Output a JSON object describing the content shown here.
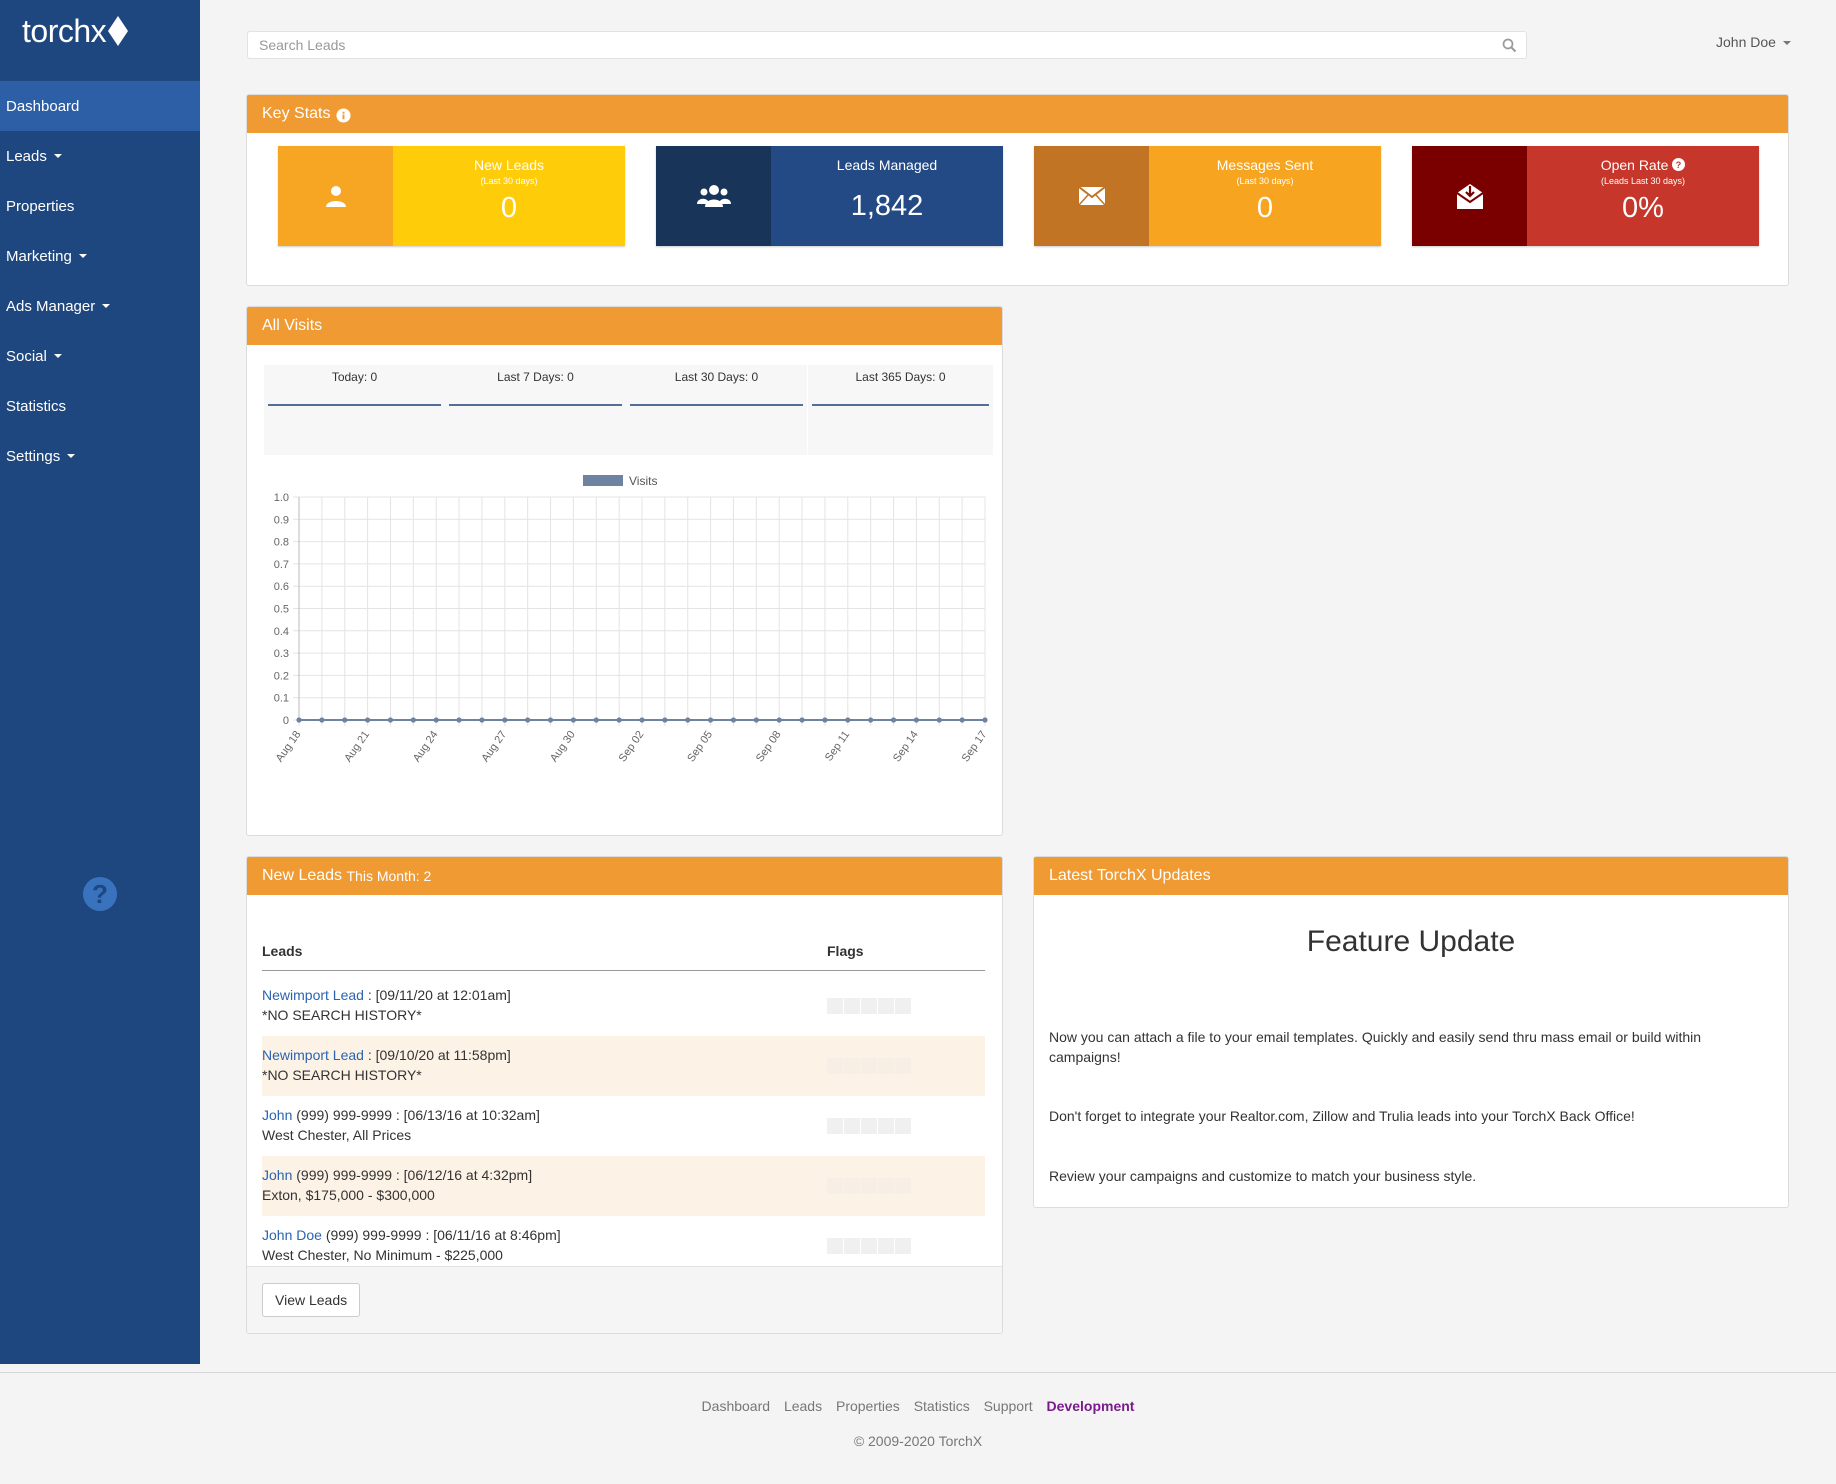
{
  "brand": {
    "logo_text": "torchx"
  },
  "sidebar": {
    "items": [
      {
        "label": "Dashboard"
      },
      {
        "label": "Leads"
      },
      {
        "label": "Properties"
      },
      {
        "label": "Marketing"
      },
      {
        "label": "Ads Manager"
      },
      {
        "label": "Social"
      },
      {
        "label": "Statistics"
      },
      {
        "label": "Settings"
      }
    ],
    "help_glyph": "?"
  },
  "search": {
    "placeholder": "Search Leads"
  },
  "user": {
    "name": "John Doe"
  },
  "key_stats": {
    "title": "Key Stats",
    "cards": [
      {
        "title": "New Leads",
        "sub": "(Last 30 days)",
        "value": "0",
        "icon": "user-icon",
        "icon_bg": "#f6a623",
        "body_bg": "#ffcc0a"
      },
      {
        "title": "Leads Managed",
        "sub": "",
        "value": "1,842",
        "icon": "users-icon",
        "icon_bg": "#183559",
        "body_bg": "#234a84"
      },
      {
        "title": "Messages Sent",
        "sub": "(Last 30 days)",
        "value": "0",
        "icon": "envelope-icon",
        "icon_bg": "#c27425",
        "body_bg": "#f7a520"
      },
      {
        "title": "Open Rate",
        "sub": "(Leads Last 30 days)",
        "value": "0%",
        "icon": "envelope-open-icon",
        "icon_bg": "#7a0000",
        "body_bg": "#c6362a"
      }
    ]
  },
  "all_visits": {
    "title": "All Visits",
    "boxes": [
      {
        "label": "Today: 0"
      },
      {
        "label": "Last 7 Days: 0"
      },
      {
        "label": "Last 30 Days: 0"
      },
      {
        "label": "Last 365 Days: 0"
      }
    ]
  },
  "chart_data": {
    "type": "line",
    "title": "",
    "xlabel": "",
    "ylabel": "",
    "ylim": [
      0,
      1
    ],
    "yticks": [
      "1.0",
      "0.9",
      "0.8",
      "0.7",
      "0.6",
      "0.5",
      "0.4",
      "0.3",
      "0.2",
      "0.1",
      "0"
    ],
    "x": [
      "Aug 18",
      "Aug 19",
      "Aug 20",
      "Aug 21",
      "Aug 22",
      "Aug 23",
      "Aug 24",
      "Aug 25",
      "Aug 26",
      "Aug 27",
      "Aug 28",
      "Aug 29",
      "Aug 30",
      "Aug 31",
      "Sep 01",
      "Sep 02",
      "Sep 03",
      "Sep 04",
      "Sep 05",
      "Sep 06",
      "Sep 07",
      "Sep 08",
      "Sep 09",
      "Sep 10",
      "Sep 11",
      "Sep 12",
      "Sep 13",
      "Sep 14",
      "Sep 15",
      "Sep 16",
      "Sep 17"
    ],
    "xtick_labels": [
      "Aug 18",
      "Aug 21",
      "Aug 24",
      "Aug 27",
      "Aug 30",
      "Sep 02",
      "Sep 05",
      "Sep 08",
      "Sep 11",
      "Sep 14",
      "Sep 17"
    ],
    "series": [
      {
        "name": "Visits",
        "values": [
          0,
          0,
          0,
          0,
          0,
          0,
          0,
          0,
          0,
          0,
          0,
          0,
          0,
          0,
          0,
          0,
          0,
          0,
          0,
          0,
          0,
          0,
          0,
          0,
          0,
          0,
          0,
          0,
          0,
          0,
          0
        ]
      }
    ],
    "legend": "top",
    "grid": true,
    "series_color": "#6e839f"
  },
  "new_leads": {
    "title_prefix": "New Leads",
    "title_suffix": "This Month: 2",
    "headers": {
      "leads": "Leads",
      "flags": "Flags"
    },
    "rows": [
      {
        "name": "Newimport Lead",
        "rest": " : [09/11/20 at 12:01am]",
        "line2": "*NO SEARCH HISTORY*"
      },
      {
        "name": "Newimport Lead",
        "rest": " : [09/10/20 at 11:58pm]",
        "line2": "*NO SEARCH HISTORY*"
      },
      {
        "name": "John",
        "rest": " (999) 999-9999 : [06/13/16 at 10:32am]",
        "line2": "West Chester, All Prices"
      },
      {
        "name": "John",
        "rest": " (999) 999-9999 : [06/12/16 at 4:32pm]",
        "line2": "Exton, $175,000 - $300,000"
      },
      {
        "name": "John Doe",
        "rest": " (999) 999-9999 : [06/11/16 at 8:46pm]",
        "line2": "West Chester, No Minimum - $225,000"
      }
    ],
    "button": "View Leads"
  },
  "updates": {
    "title": "Latest TorchX Updates",
    "heading": "Feature Update",
    "paragraphs": [
      "Now you can attach a file to your email templates. Quickly and easily send thru mass email or build within campaigns!",
      "Don't forget to integrate your Realtor.com, Zillow and Trulia leads into your TorchX Back Office!",
      "Review your campaigns and customize to match your business style."
    ]
  },
  "footer": {
    "links": [
      "Dashboard",
      "Leads",
      "Properties",
      "Statistics",
      "Support",
      "Development"
    ],
    "copyright": "© 2009-2020 TorchX"
  }
}
